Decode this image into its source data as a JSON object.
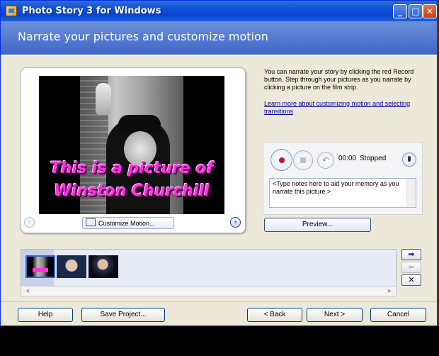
{
  "window": {
    "title": "Photo Story 3 for Windows",
    "minimize_glyph": "_",
    "maximize_glyph": "□",
    "close_glyph": "✕"
  },
  "header": {
    "title": "Narrate your pictures and customize motion"
  },
  "photo": {
    "caption_line1": "This is a picture of",
    "caption_line2": "Winston Churchill",
    "prev_glyph": "‹",
    "next_glyph": "›",
    "customize_motion_label": "Customize Motion..."
  },
  "instructions": {
    "text": "You can narrate your story by clicking the red Record button. Step through your pictures as you narrate by clicking a picture on the film strip.",
    "link": "Learn more about customizing motion and selecting transitions"
  },
  "recorder": {
    "time": "00:00",
    "status": "Stopped",
    "undo_glyph": "↶",
    "notes": "<Type notes here to aid your memory as you narrate this picture.>"
  },
  "preview_label": "Preview...",
  "filmstrip": {
    "side_buttons": [
      "➡",
      "⬅",
      "✕"
    ],
    "scroll_left": "◀",
    "scroll_right": "▶"
  },
  "footer": {
    "help": "Help",
    "save_project": "Save Project...",
    "back": "< Back",
    "next": "Next >",
    "cancel": "Cancel"
  },
  "colors": {
    "titlebar": "#0b4fd6",
    "caption": "#ff33dd",
    "record": "#c8102e",
    "link": "#0000aa"
  },
  "icons": [
    "app-icon",
    "customize-motion-icon",
    "record-icon",
    "stop-icon",
    "undo-icon",
    "microphone-icon"
  ]
}
